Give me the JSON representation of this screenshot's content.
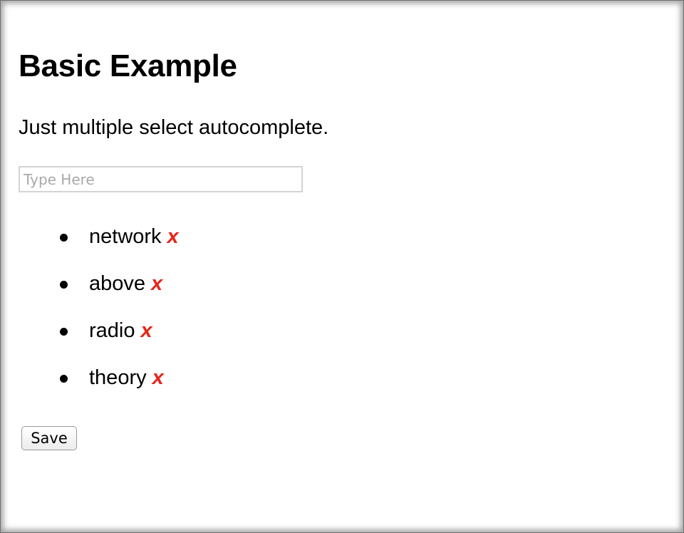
{
  "page": {
    "title": "Basic Example",
    "description": "Just multiple select autocomplete."
  },
  "search": {
    "placeholder": "Type Here",
    "value": ""
  },
  "tags": [
    {
      "label": "network",
      "remove": "x"
    },
    {
      "label": "above",
      "remove": "x"
    },
    {
      "label": "radio",
      "remove": "x"
    },
    {
      "label": "theory",
      "remove": "x"
    }
  ],
  "actions": {
    "save_label": "Save"
  },
  "colors": {
    "remove_x": "#e8241a",
    "input_border": "#d4d4d4"
  }
}
